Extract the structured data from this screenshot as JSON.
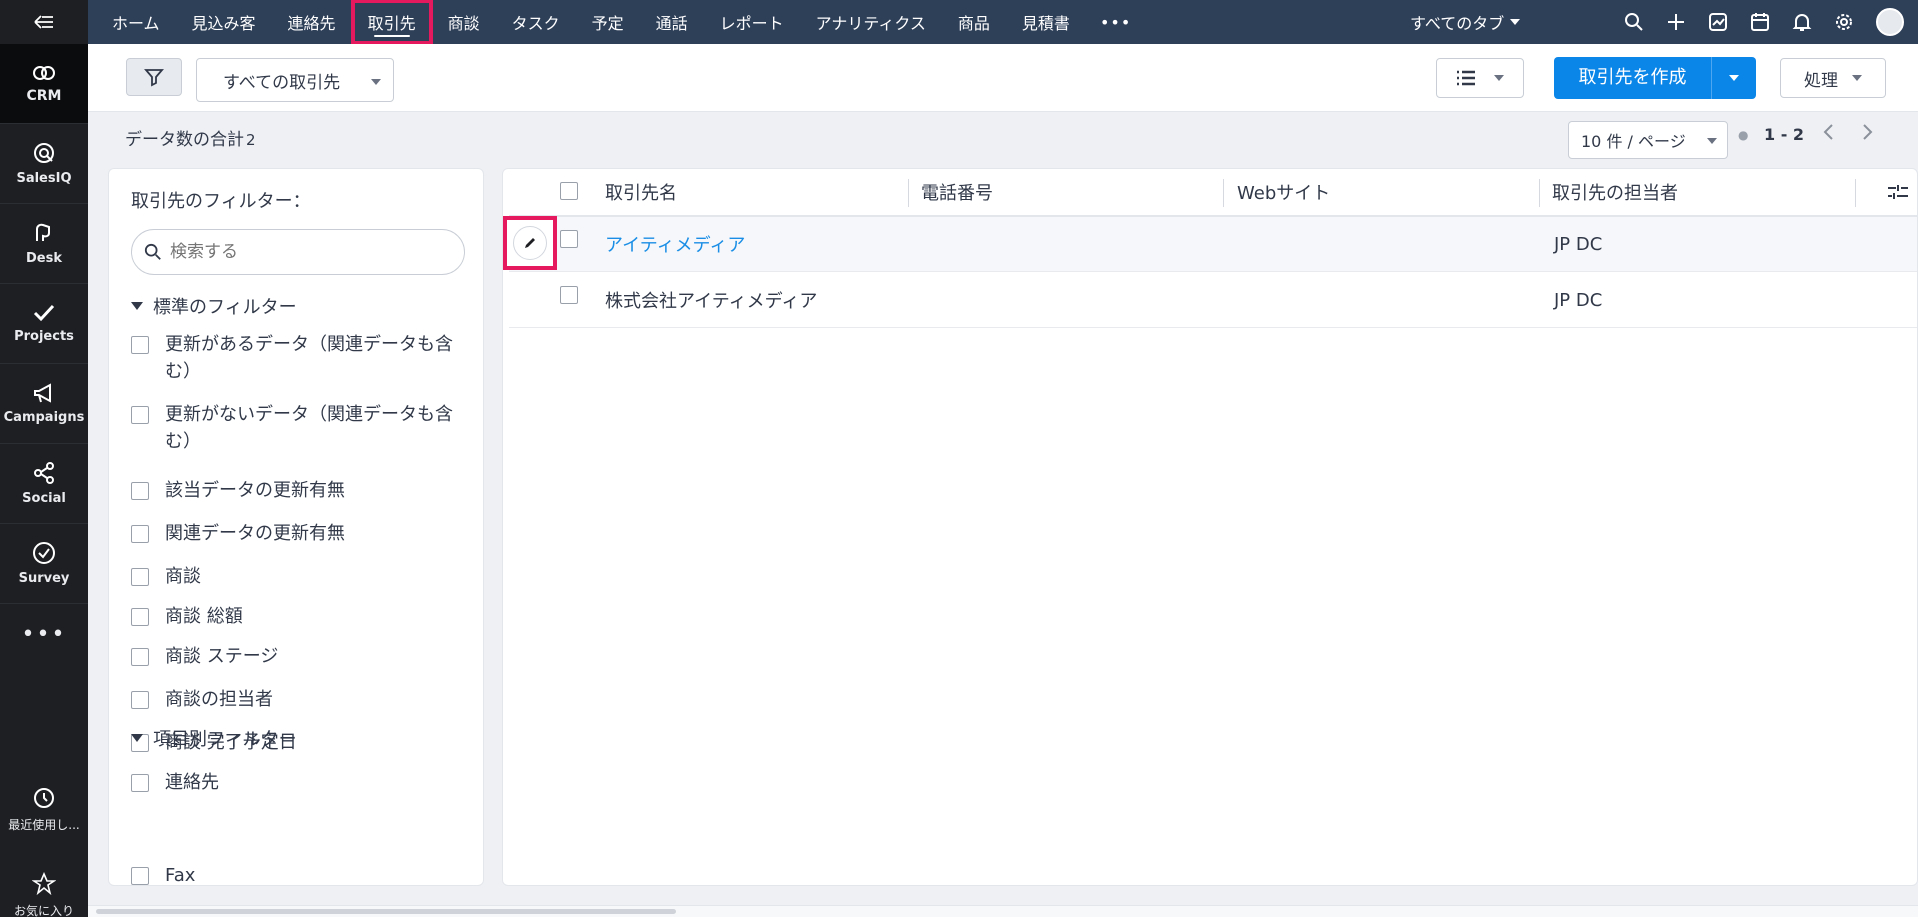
{
  "rail": {
    "items": [
      {
        "label": "CRM",
        "icon": "crm-icon"
      },
      {
        "label": "SalesIQ",
        "icon": "salesiq-icon"
      },
      {
        "label": "Desk",
        "icon": "desk-icon"
      },
      {
        "label": "Projects",
        "icon": "projects-icon"
      },
      {
        "label": "Campaigns",
        "icon": "campaigns-icon"
      },
      {
        "label": "Social",
        "icon": "social-icon"
      },
      {
        "label": "Survey",
        "icon": "survey-icon"
      }
    ],
    "more": "•••",
    "recent": "最近使用し...",
    "favorites": "お気に入り"
  },
  "nav": {
    "tabs": [
      "ホーム",
      "見込み客",
      "連絡先",
      "取引先",
      "商談",
      "タスク",
      "予定",
      "通話",
      "レポート",
      "アナリティクス",
      "商品",
      "見積書"
    ],
    "active_index": 3,
    "more": "•••",
    "all_tabs": "すべてのタブ"
  },
  "toolbar": {
    "view_select": "すべての取引先",
    "create_button": "取引先を作成",
    "action_button": "処理"
  },
  "summary": {
    "total_label": "データ数の合計",
    "total_count": "2",
    "page_size": "10 件 / ページ",
    "range": "1 - 2"
  },
  "filters": {
    "title": "取引先のフィルター：",
    "search_placeholder": "検索する",
    "standard_section": "標準のフィルター",
    "standard_items": [
      "更新があるデータ（関連データも含む）",
      "更新がないデータ（関連データも含む）",
      "該当データの更新有無",
      "関連データの更新有無",
      "商談",
      "商談 総額",
      "商談 ステージ",
      "商談の担当者",
      "商談 完了予定日",
      "連絡先"
    ],
    "field_section": "項目別フィルター",
    "field_items": [
      "Fax"
    ]
  },
  "table": {
    "columns": [
      "取引先名",
      "電話番号",
      "Webサイト",
      "取引先の担当者"
    ],
    "rows": [
      {
        "name": "アイティメディア",
        "phone": "",
        "website": "",
        "owner": "JP DC"
      },
      {
        "name": "株式会社アイティメディア",
        "phone": "",
        "website": "",
        "owner": "JP DC"
      }
    ]
  },
  "colors": {
    "rail_bg": "#1d1f23",
    "nav_bg": "#2e3f58",
    "accent": "#0a85e8",
    "highlight": "#e5195e",
    "link": "#1a8ee6"
  }
}
